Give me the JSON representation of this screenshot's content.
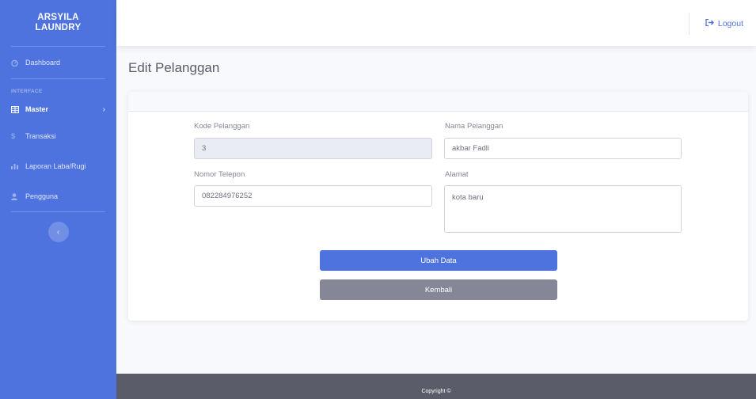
{
  "sidebar": {
    "brand_line1": "ARSYILA",
    "brand_line2": "LAUNDRY",
    "dashboard": "Dashboard",
    "heading": "INTERFACE",
    "master": "Master",
    "transaksi": "Transaksi",
    "laporan": "Laporan Laba/Rugi",
    "pengguna": "Pengguna",
    "toggle_glyph": "‹"
  },
  "topbar": {
    "logout": "Logout"
  },
  "page": {
    "title": "Edit Pelanggan"
  },
  "form": {
    "kode_label": "Kode Pelanggan",
    "kode_value": "3",
    "nama_label": "Nama Pelanggan",
    "nama_value": "akbar Fadli",
    "telepon_label": "Nomor Telepon",
    "telepon_value": "082284976252",
    "alamat_label": "Alamat",
    "alamat_value": "kota baru",
    "submit": "Ubah Data",
    "back": "Kembali"
  },
  "footer": {
    "copyright": "Copyright ©"
  },
  "colors": {
    "primary": "#4e73df",
    "secondary": "#858796",
    "footer": "#5a5c69"
  }
}
